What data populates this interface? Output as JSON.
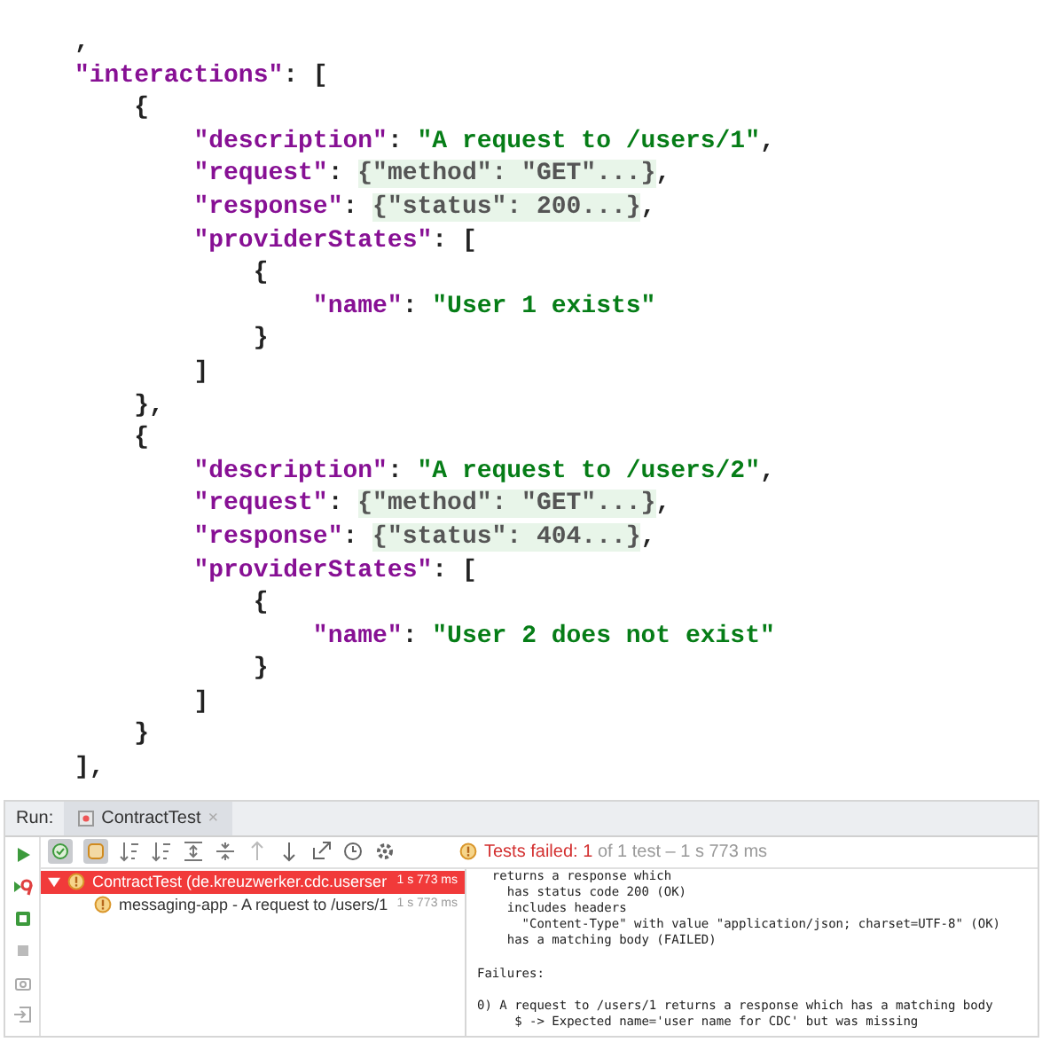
{
  "code_lines": [
    {
      "tokens": [
        {
          "kind": "punct",
          "text": ","
        }
      ]
    },
    {
      "tokens": [
        {
          "kind": "key",
          "text": "\"interactions\""
        },
        {
          "kind": "punct",
          "text": ": ["
        }
      ]
    },
    {
      "tokens": [
        {
          "kind": "punct",
          "text": "    {"
        }
      ]
    },
    {
      "tokens": [
        {
          "kind": "key",
          "text": "        \"description\""
        },
        {
          "kind": "punct",
          "text": ": "
        },
        {
          "kind": "string",
          "text": "\"A request to /users/1\""
        },
        {
          "kind": "punct",
          "text": ","
        }
      ]
    },
    {
      "tokens": [
        {
          "kind": "key",
          "text": "        \"request\""
        },
        {
          "kind": "punct",
          "text": ": "
        },
        {
          "kind": "folded",
          "text": "{\"method\": \"GET\"...}"
        },
        {
          "kind": "punct",
          "text": ","
        }
      ]
    },
    {
      "tokens": [
        {
          "kind": "key",
          "text": "        \"response\""
        },
        {
          "kind": "punct",
          "text": ": "
        },
        {
          "kind": "folded",
          "text": "{\"status\": 200...}"
        },
        {
          "kind": "punct",
          "text": ","
        }
      ]
    },
    {
      "tokens": [
        {
          "kind": "key",
          "text": "        \"providerStates\""
        },
        {
          "kind": "punct",
          "text": ": ["
        }
      ]
    },
    {
      "tokens": [
        {
          "kind": "punct",
          "text": "            {"
        }
      ]
    },
    {
      "tokens": [
        {
          "kind": "key",
          "text": "                \"name\""
        },
        {
          "kind": "punct",
          "text": ": "
        },
        {
          "kind": "string",
          "text": "\"User 1 exists\""
        }
      ]
    },
    {
      "tokens": [
        {
          "kind": "punct",
          "text": "            }"
        }
      ]
    },
    {
      "tokens": [
        {
          "kind": "punct",
          "text": "        ]"
        }
      ]
    },
    {
      "tokens": [
        {
          "kind": "punct",
          "text": "    },"
        }
      ]
    },
    {
      "tokens": [
        {
          "kind": "punct",
          "text": "    {"
        }
      ]
    },
    {
      "tokens": [
        {
          "kind": "key",
          "text": "        \"description\""
        },
        {
          "kind": "punct",
          "text": ": "
        },
        {
          "kind": "string",
          "text": "\"A request to /users/2\""
        },
        {
          "kind": "punct",
          "text": ","
        }
      ]
    },
    {
      "tokens": [
        {
          "kind": "key",
          "text": "        \"request\""
        },
        {
          "kind": "punct",
          "text": ": "
        },
        {
          "kind": "folded",
          "text": "{\"method\": \"GET\"...}"
        },
        {
          "kind": "punct",
          "text": ","
        }
      ]
    },
    {
      "tokens": [
        {
          "kind": "key",
          "text": "        \"response\""
        },
        {
          "kind": "punct",
          "text": ": "
        },
        {
          "kind": "folded",
          "text": "{\"status\": 404...}"
        },
        {
          "kind": "punct",
          "text": ","
        }
      ]
    },
    {
      "tokens": [
        {
          "kind": "key",
          "text": "        \"providerStates\""
        },
        {
          "kind": "punct",
          "text": ": ["
        }
      ]
    },
    {
      "tokens": [
        {
          "kind": "punct",
          "text": "            {"
        }
      ]
    },
    {
      "tokens": [
        {
          "kind": "key",
          "text": "                \"name\""
        },
        {
          "kind": "punct",
          "text": ": "
        },
        {
          "kind": "string",
          "text": "\"User 2 does not exist\""
        }
      ]
    },
    {
      "tokens": [
        {
          "kind": "punct",
          "text": "            }"
        }
      ]
    },
    {
      "tokens": [
        {
          "kind": "punct",
          "text": "        ]"
        }
      ]
    },
    {
      "tokens": [
        {
          "kind": "punct",
          "text": "    }"
        }
      ]
    },
    {
      "tokens": [
        {
          "kind": "punct",
          "text": "],"
        }
      ]
    }
  ],
  "run_panel": {
    "label": "Run:",
    "tab": {
      "title": "ContractTest",
      "close": "×",
      "selected": true
    },
    "toggles": [
      {
        "kind": "passed",
        "on": true
      },
      {
        "kind": "ignored",
        "on": true
      }
    ],
    "status": {
      "failed": "Tests failed: 1",
      "rest": "of 1 test – 1 s 773 ms"
    },
    "tree": [
      {
        "label": "ContractTest (de.kreuzwerker.cdc.userser",
        "time": "1 s 773 ms",
        "expanded": true,
        "selected": true,
        "children": [
          {
            "label": "messaging-app - A request to /users/1",
            "time": "1 s 773 ms",
            "selected": false
          }
        ]
      }
    ],
    "console": [
      [
        "  returns a response which",
        "    has status code 200 (OK)",
        "    includes headers",
        "      \"Content-Type\" with value \"application/json; charset=UTF-8\" (OK)",
        "    has a matching body (FAILED)"
      ],
      [
        "Failures:"
      ],
      [
        "0) A request to /users/1 returns a response which has a matching body",
        "     $ -> Expected name='user name for CDC' but was missing"
      ]
    ]
  }
}
